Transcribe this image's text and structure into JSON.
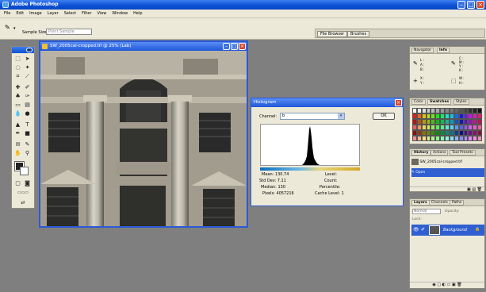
{
  "app": {
    "title": "Adobe Photoshop",
    "menu": [
      "File",
      "Edit",
      "Image",
      "Layer",
      "Select",
      "Filter",
      "View",
      "Window",
      "Help"
    ]
  },
  "options": {
    "sample_size_label": "Sample Size:",
    "sample_size_value": "Point Sample",
    "well_tabs": [
      "File Browser",
      "Brushes"
    ]
  },
  "document": {
    "title": "SW_2005cal-cropped.tif @ 25% (Lab)"
  },
  "histogram": {
    "title": "Histogram",
    "channel_label": "Channel:",
    "channel_value": "b",
    "ok_label": "OK",
    "stats_left": {
      "mean": "Mean: 130.74",
      "stddev": "Std Dev: 7.11",
      "median": "Median: 130",
      "pixels": "Pixels: 4057216"
    },
    "stats_right": {
      "level": "Level:",
      "count": "Count:",
      "percentile": "Percentile:",
      "cache": "Cache Level: 1"
    }
  },
  "panels": {
    "navigator_tabs": [
      "Navigator",
      "Info"
    ],
    "info": {
      "l": "L :",
      "a": "A :",
      "b": "B :",
      "c": "C :",
      "m": "M :",
      "y": "Y :",
      "k": "K :",
      "x": "X :",
      "y2": "Y :",
      "w": "W :",
      "h": "H :"
    },
    "color_tabs": [
      "Color",
      "Swatches",
      "Styles"
    ],
    "history_tabs": [
      "History",
      "Actions",
      "Tool Presets"
    ],
    "history_items": [
      "SW_2005cal-cropped.tif",
      "Open"
    ],
    "layers_tabs": [
      "Layers",
      "Channels",
      "Paths"
    ],
    "layers_blend": "Normal",
    "layers_opacity_label": "Opacity:",
    "layers_lock_label": "Lock:",
    "layer_name": "Background"
  },
  "colors": {
    "accent": "#0b4fd3",
    "panel_bg": "#ece9d8",
    "workspace": "#7f7f7f"
  }
}
